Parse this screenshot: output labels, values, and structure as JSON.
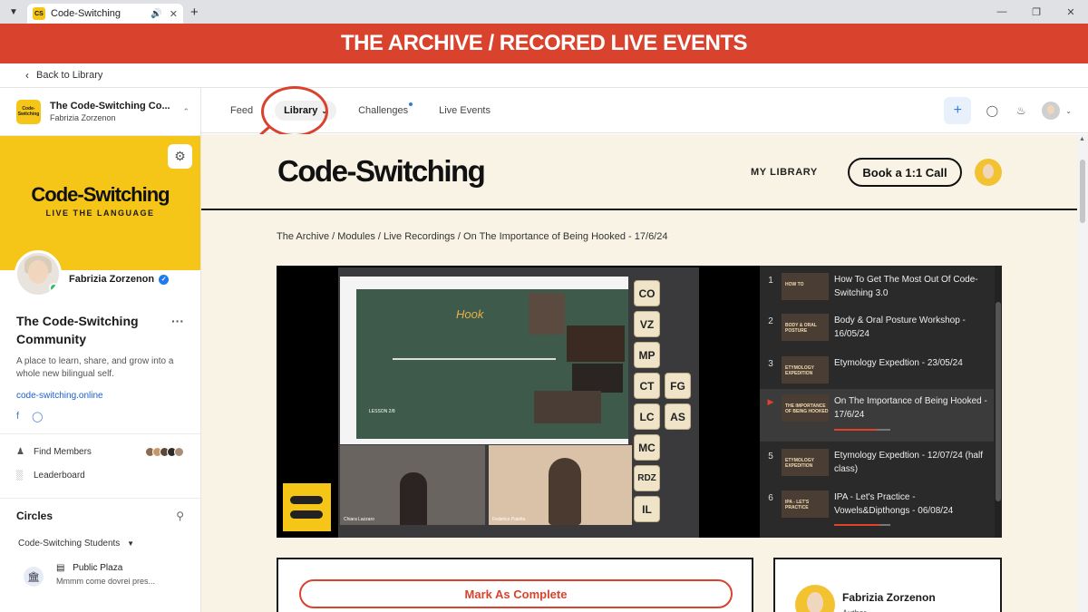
{
  "browser": {
    "tab_title": "Code-Switching",
    "favicon_text": "CS",
    "new_tab": "+"
  },
  "banner": {
    "text": "THE ARCHIVE / RECORED LIVE EVENTS"
  },
  "back": {
    "label": "Back to Library"
  },
  "sidebar": {
    "community_name": "The Code-Switching Co...",
    "community_owner": "Fabrizia Zorzenon",
    "logo_text": "Code-Switching",
    "cover_title": "Code-Switching",
    "cover_subtitle": "LIVE THE LANGUAGE",
    "profile_name": "Fabrizia Zorzenon",
    "community_title": "The Code-Switching Community",
    "description": "A place to learn, share, and grow into a whole new bilingual self.",
    "link": "code-switching.online",
    "menu": [
      {
        "label": "Find Members"
      },
      {
        "label": "Leaderboard"
      }
    ],
    "circles_title": "Circles",
    "circle_group": "Code-Switching Students",
    "plaza_title": "Public Plaza",
    "plaza_preview": "Mmmm come dovrei pres..."
  },
  "topnav": {
    "items": [
      {
        "label": "Feed"
      },
      {
        "label": "Library"
      },
      {
        "label": "Challenges"
      },
      {
        "label": "Live Events"
      }
    ],
    "plus": "+"
  },
  "site": {
    "logo": "Code-Switching",
    "my_library": "MY LIBRARY",
    "book_button": "Book a 1:1 Call"
  },
  "breadcrumb": "The Archive / Modules / Live Recordings / On The Importance of Being Hooked - 17/6/24",
  "video": {
    "chips": [
      "CO",
      "VZ",
      "MP",
      "CT",
      "FG",
      "LC",
      "AS",
      "MC",
      "RDZ",
      "IL"
    ],
    "slide_heading": "Hook",
    "slide_lesson": "LESSON 2/8",
    "cam1_label": "Chiara Lazzaro",
    "cam2_label": "Federico Patella"
  },
  "playlist": [
    {
      "num": "1",
      "title": "How To Get The Most Out Of Code-Switching 3.0",
      "thumb": "HOW TO",
      "progress": null,
      "active": false
    },
    {
      "num": "2",
      "title": "Body & Oral Posture Workshop - 16/05/24",
      "thumb": "BODY & ORAL POSTURE",
      "progress": null,
      "active": false
    },
    {
      "num": "3",
      "title": "Etymology Expedtion - 23/05/24",
      "thumb": "ETYMOLOGY EXPEDITION",
      "progress": null,
      "active": false
    },
    {
      "num": "",
      "title": "On The Importance of Being Hooked - 17/6/24",
      "thumb": "THE IMPORTANCE OF BEING HOOKED",
      "progress": 0.75,
      "active": true
    },
    {
      "num": "5",
      "title": "Etymology Expedtion - 12/07/24 (half class)",
      "thumb": "ETYMOLOGY EXPEDITION",
      "progress": null,
      "active": false
    },
    {
      "num": "6",
      "title": "IPA - Let's Practice - Vowels&Dipthongs - 06/08/24",
      "thumb": "IPA - LET'S PRACTICE",
      "progress": 0.8,
      "active": false
    }
  ],
  "actions": {
    "mark_complete": "Mark As Complete"
  },
  "author": {
    "name": "Fabrizia Zorzenon",
    "role": "Author"
  },
  "colors": {
    "accent_red": "#d9432e",
    "brand_yellow": "#f5c518",
    "page_cream": "#f8f3e4"
  }
}
